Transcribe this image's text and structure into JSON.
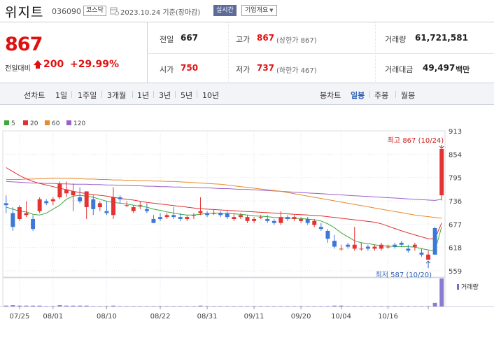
{
  "header": {
    "stock_name": "위지트",
    "stock_code": "036090",
    "market": "코스닥",
    "date": "2023.10.24 기준(장마감)",
    "realtime_label": "실시간",
    "company_label": "기업개요"
  },
  "price": {
    "current": "867",
    "change_label": "전일대비",
    "change": "200",
    "change_pct": "+29.99%",
    "color_up": "#e01010"
  },
  "stats": {
    "prev_label": "전일",
    "prev": "667",
    "open_label": "시가",
    "open": "750",
    "high_label": "고가",
    "high": "867",
    "high_note": "(상한가 867)",
    "low_label": "저가",
    "low": "737",
    "low_note": "(하한가 467)",
    "volume_label": "거래량",
    "volume": "61,721,581",
    "amount_label": "거래대금",
    "amount": "49,497",
    "amount_unit": "백만"
  },
  "periods": {
    "label": "선차트",
    "items": [
      "1일",
      "1주일",
      "3개월",
      "1년",
      "3년",
      "5년",
      "10년"
    ]
  },
  "candle_types": {
    "label": "봉차트",
    "items": [
      "일봉",
      "주봉",
      "월봉"
    ],
    "active": "일봉"
  },
  "chart_data": {
    "type": "candlestick",
    "legend": [
      {
        "name": "5",
        "color": "#3da83d"
      },
      {
        "name": "20",
        "color": "#e03030"
      },
      {
        "name": "60",
        "color": "#e8892a"
      },
      {
        "name": "120",
        "color": "#9a60c8"
      }
    ],
    "y_ticks": [
      913,
      854,
      795,
      736,
      677,
      618,
      559
    ],
    "ylim": [
      559,
      913
    ],
    "x_ticks": [
      {
        "label": "07/25",
        "i": 2
      },
      {
        "label": "08/01",
        "i": 7
      },
      {
        "label": "08/10",
        "i": 15
      },
      {
        "label": "08/22",
        "i": 23
      },
      {
        "label": "08/31",
        "i": 30
      },
      {
        "label": "09/11",
        "i": 37
      },
      {
        "label": "09/20",
        "i": 44
      },
      {
        "label": "10/04",
        "i": 50
      },
      {
        "label": "10/16",
        "i": 57
      },
      {
        "label": "",
        "i": 63
      }
    ],
    "annotations": {
      "high_label": "최고 867 (10/24)",
      "low_label": "최저 587 (10/20)"
    },
    "volume_label": "거래량",
    "candles": [
      [
        730,
        750,
        705,
        725
      ],
      [
        705,
        720,
        660,
        670
      ],
      [
        690,
        725,
        685,
        720
      ],
      [
        700,
        735,
        695,
        705
      ],
      [
        690,
        700,
        660,
        665
      ],
      [
        710,
        745,
        705,
        740
      ],
      [
        735,
        740,
        725,
        730
      ],
      [
        735,
        745,
        725,
        740
      ],
      [
        745,
        785,
        740,
        780
      ],
      [
        755,
        785,
        745,
        765
      ],
      [
        750,
        780,
        710,
        760
      ],
      [
        745,
        770,
        730,
        735
      ],
      [
        720,
        760,
        690,
        760
      ],
      [
        740,
        750,
        700,
        715
      ],
      [
        720,
        735,
        710,
        730
      ],
      [
        710,
        735,
        700,
        705
      ],
      [
        700,
        770,
        690,
        745
      ],
      [
        745,
        750,
        730,
        740
      ],
      [
        725,
        735,
        720,
        725
      ],
      [
        710,
        725,
        705,
        720
      ],
      [
        725,
        735,
        715,
        725
      ],
      [
        715,
        730,
        705,
        710
      ],
      [
        690,
        700,
        680,
        680
      ],
      [
        695,
        705,
        685,
        690
      ],
      [
        695,
        705,
        690,
        700
      ],
      [
        700,
        720,
        690,
        695
      ],
      [
        695,
        705,
        685,
        690
      ],
      [
        690,
        700,
        685,
        695
      ],
      [
        700,
        705,
        690,
        700
      ],
      [
        705,
        745,
        700,
        710
      ],
      [
        705,
        710,
        695,
        700
      ],
      [
        705,
        715,
        700,
        705
      ],
      [
        705,
        710,
        695,
        700
      ],
      [
        705,
        710,
        690,
        695
      ],
      [
        690,
        705,
        685,
        695
      ],
      [
        695,
        705,
        690,
        700
      ],
      [
        685,
        700,
        680,
        695
      ],
      [
        685,
        695,
        680,
        690
      ],
      [
        695,
        700,
        690,
        695
      ],
      [
        690,
        700,
        680,
        685
      ],
      [
        685,
        690,
        675,
        680
      ],
      [
        680,
        710,
        675,
        695
      ],
      [
        695,
        700,
        685,
        690
      ],
      [
        690,
        700,
        685,
        695
      ],
      [
        685,
        695,
        680,
        690
      ],
      [
        690,
        695,
        675,
        680
      ],
      [
        675,
        690,
        670,
        685
      ],
      [
        670,
        680,
        660,
        665
      ],
      [
        660,
        665,
        630,
        640
      ],
      [
        635,
        650,
        615,
        620
      ],
      [
        615,
        625,
        610,
        615
      ],
      [
        625,
        630,
        615,
        620
      ],
      [
        615,
        670,
        610,
        625
      ],
      [
        615,
        630,
        610,
        615
      ],
      [
        620,
        625,
        610,
        615
      ],
      [
        615,
        625,
        610,
        620
      ],
      [
        615,
        630,
        610,
        625
      ],
      [
        620,
        625,
        615,
        620
      ],
      [
        625,
        630,
        615,
        620
      ],
      [
        630,
        635,
        620,
        625
      ],
      [
        615,
        625,
        605,
        610
      ],
      [
        620,
        630,
        610,
        625
      ],
      [
        605,
        615,
        595,
        600
      ],
      [
        587,
        610,
        587,
        600
      ],
      [
        667,
        670,
        600,
        600
      ],
      [
        750,
        867,
        737,
        867
      ]
    ],
    "ma5": [
      720,
      715,
      710,
      708,
      702,
      700,
      705,
      715,
      725,
      740,
      748,
      750,
      748,
      745,
      740,
      735,
      732,
      730,
      728,
      725,
      722,
      720,
      715,
      712,
      708,
      705,
      702,
      700,
      700,
      702,
      704,
      705,
      705,
      704,
      703,
      702,
      700,
      698,
      697,
      696,
      694,
      693,
      692,
      692,
      691,
      690,
      688,
      685,
      678,
      668,
      655,
      645,
      635,
      630,
      628,
      625,
      622,
      622,
      620,
      620,
      620,
      619,
      615,
      612,
      610,
      670
    ],
    "ma20": [
      820,
      810,
      800,
      792,
      785,
      780,
      776,
      772,
      768,
      764,
      760,
      757,
      754,
      752,
      750,
      748,
      745,
      742,
      740,
      738,
      735,
      732,
      730,
      728,
      726,
      724,
      722,
      720,
      718,
      716,
      715,
      714,
      713,
      712,
      711,
      710,
      709,
      708,
      707,
      706,
      705,
      704,
      703,
      702,
      701,
      700,
      699,
      698,
      696,
      694,
      692,
      690,
      688,
      686,
      684,
      682,
      678,
      672,
      666,
      660,
      655,
      650,
      645,
      640,
      640,
      680
    ],
    "ma60": [
      790,
      790,
      790,
      791,
      791,
      792,
      792,
      793,
      793,
      793,
      792,
      792,
      791,
      791,
      790,
      790,
      789,
      789,
      788,
      788,
      787,
      787,
      786,
      786,
      785,
      785,
      784,
      783,
      782,
      781,
      780,
      779,
      778,
      776,
      774,
      772,
      770,
      768,
      766,
      764,
      762,
      760,
      757,
      754,
      751,
      748,
      745,
      742,
      739,
      736,
      733,
      730,
      727,
      724,
      721,
      718,
      715,
      712,
      709,
      706,
      703,
      700,
      698,
      696,
      694,
      692
    ],
    "ma120": [
      785,
      784,
      783,
      782,
      781,
      781,
      780,
      780,
      779,
      779,
      778,
      778,
      778,
      777,
      777,
      776,
      776,
      775,
      775,
      774,
      774,
      773,
      773,
      772,
      772,
      771,
      771,
      770,
      770,
      769,
      769,
      768,
      767,
      767,
      766,
      765,
      765,
      764,
      763,
      762,
      761,
      760,
      759,
      758,
      757,
      756,
      755,
      754,
      753,
      752,
      751,
      750,
      749,
      748,
      747,
      746,
      745,
      744,
      743,
      742,
      741,
      740,
      739,
      738,
      737,
      740
    ],
    "volume": [
      2,
      3,
      2,
      2,
      2,
      2,
      1,
      1,
      3,
      2,
      2,
      2,
      2,
      1,
      1,
      1,
      2,
      1,
      1,
      1,
      1,
      1,
      1,
      1,
      1,
      1,
      1,
      1,
      1,
      2,
      1,
      1,
      1,
      1,
      1,
      1,
      1,
      1,
      1,
      1,
      1,
      1,
      1,
      1,
      1,
      1,
      1,
      1,
      1,
      2,
      2,
      1,
      1,
      1,
      1,
      1,
      1,
      1,
      1,
      1,
      1,
      1,
      1,
      1,
      8,
      62
    ]
  }
}
